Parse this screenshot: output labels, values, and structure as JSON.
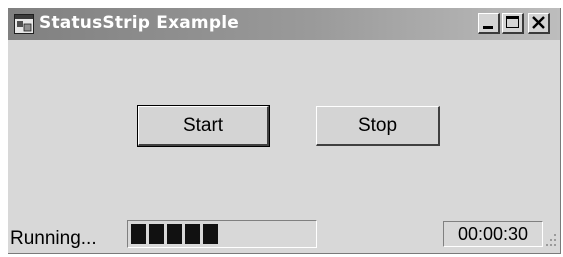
{
  "window": {
    "title": "StatusStrip Example",
    "icon": "app-window-icon"
  },
  "caption_buttons": {
    "minimize_icon": "minimize-icon",
    "maximize_icon": "maximize-icon",
    "close_icon": "close-icon"
  },
  "main": {
    "start_label": "Start",
    "stop_label": "Stop",
    "focused_button": "Start"
  },
  "status_strip": {
    "status_text": "Running...",
    "progress_fraction": 0.48,
    "timer": "00:00:30",
    "grip_icon": "resize-grip-icon"
  },
  "colors": {
    "window_bg": "#d8d8d8",
    "titlebar_dark": "#808080",
    "titlebar_light": "#bdbdbd",
    "progress_block": "#111111"
  }
}
